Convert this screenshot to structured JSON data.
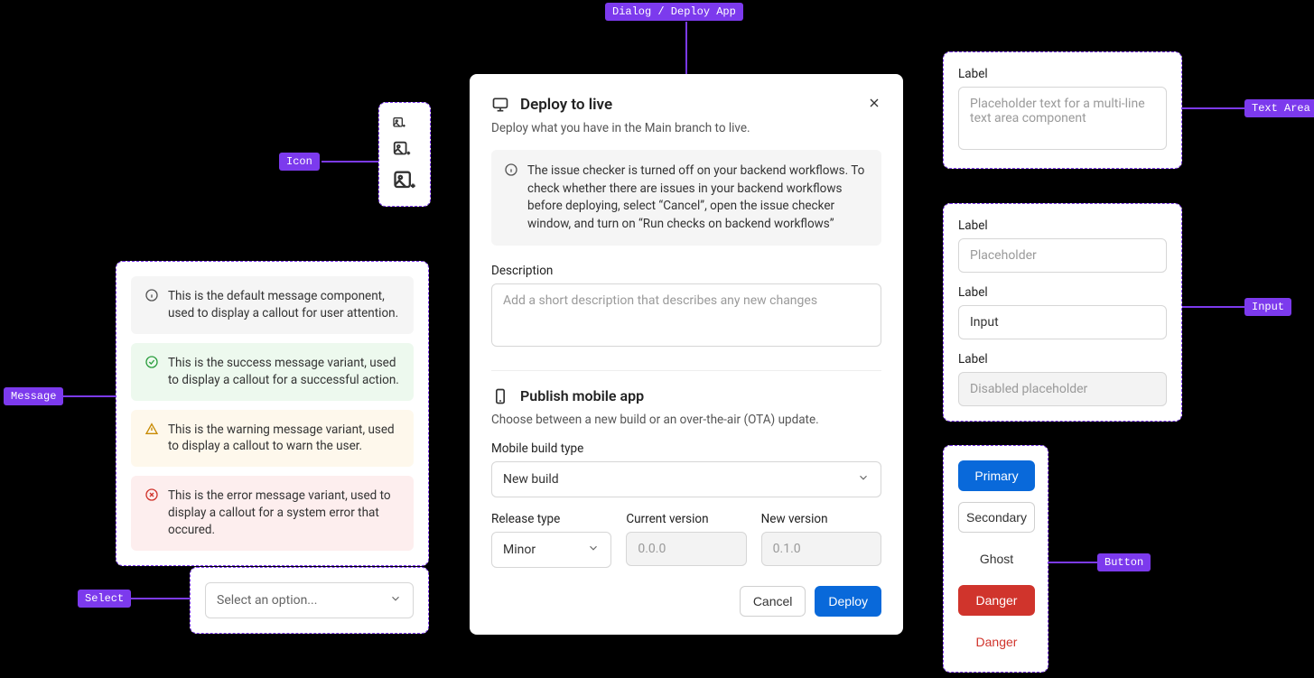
{
  "annotations": {
    "dialog": "Dialog / Deploy App",
    "icon": "Icon",
    "message": "Message",
    "select": "Select",
    "textarea": "Text Area",
    "input": "Input",
    "button": "Button"
  },
  "dialog": {
    "title": "Deploy to live",
    "subtitle": "Deploy what you have in the Main branch to live.",
    "info": "The issue checker is turned off on your backend workflows. To check whether there are issues in your backend workflows before deploying, select “Cancel”, open the issue checker window, and turn on “Run checks on backend workflows”",
    "description_label": "Description",
    "description_placeholder": "Add a short description that describes any new changes",
    "mobile_title": "Publish mobile app",
    "mobile_sub": "Choose between a new build or an over-the-air (OTA) update.",
    "buildtype_label": "Mobile build type",
    "buildtype_value": "New build",
    "release_label": "Release type",
    "release_value": "Minor",
    "current_label": "Current version",
    "current_value": "0.0.0",
    "new_label": "New version",
    "new_value": "0.1.0",
    "cancel": "Cancel",
    "deploy": "Deploy"
  },
  "messages": {
    "default": "This is the default message component, used to display a callout for user attention.",
    "success": "This is the success message variant, used to display a callout for a successful action.",
    "warning": "This is the warning message variant, used to display a callout to warn the user.",
    "error": "This is the error message variant, used to display a callout for a system error that occured."
  },
  "select_panel": {
    "placeholder": "Select an option..."
  },
  "textarea_panel": {
    "label": "Label",
    "placeholder": "Placeholder text for a multi-line text area component"
  },
  "inputs_panel": {
    "label1": "Label",
    "placeholder1": "Placeholder",
    "label2": "Label",
    "value2": "Input",
    "label3": "Label",
    "placeholder3": "Disabled placeholder"
  },
  "buttons_panel": {
    "primary": "Primary",
    "secondary": "Secondary",
    "ghost": "Ghost",
    "danger": "Danger",
    "danger_ghost": "Danger"
  }
}
